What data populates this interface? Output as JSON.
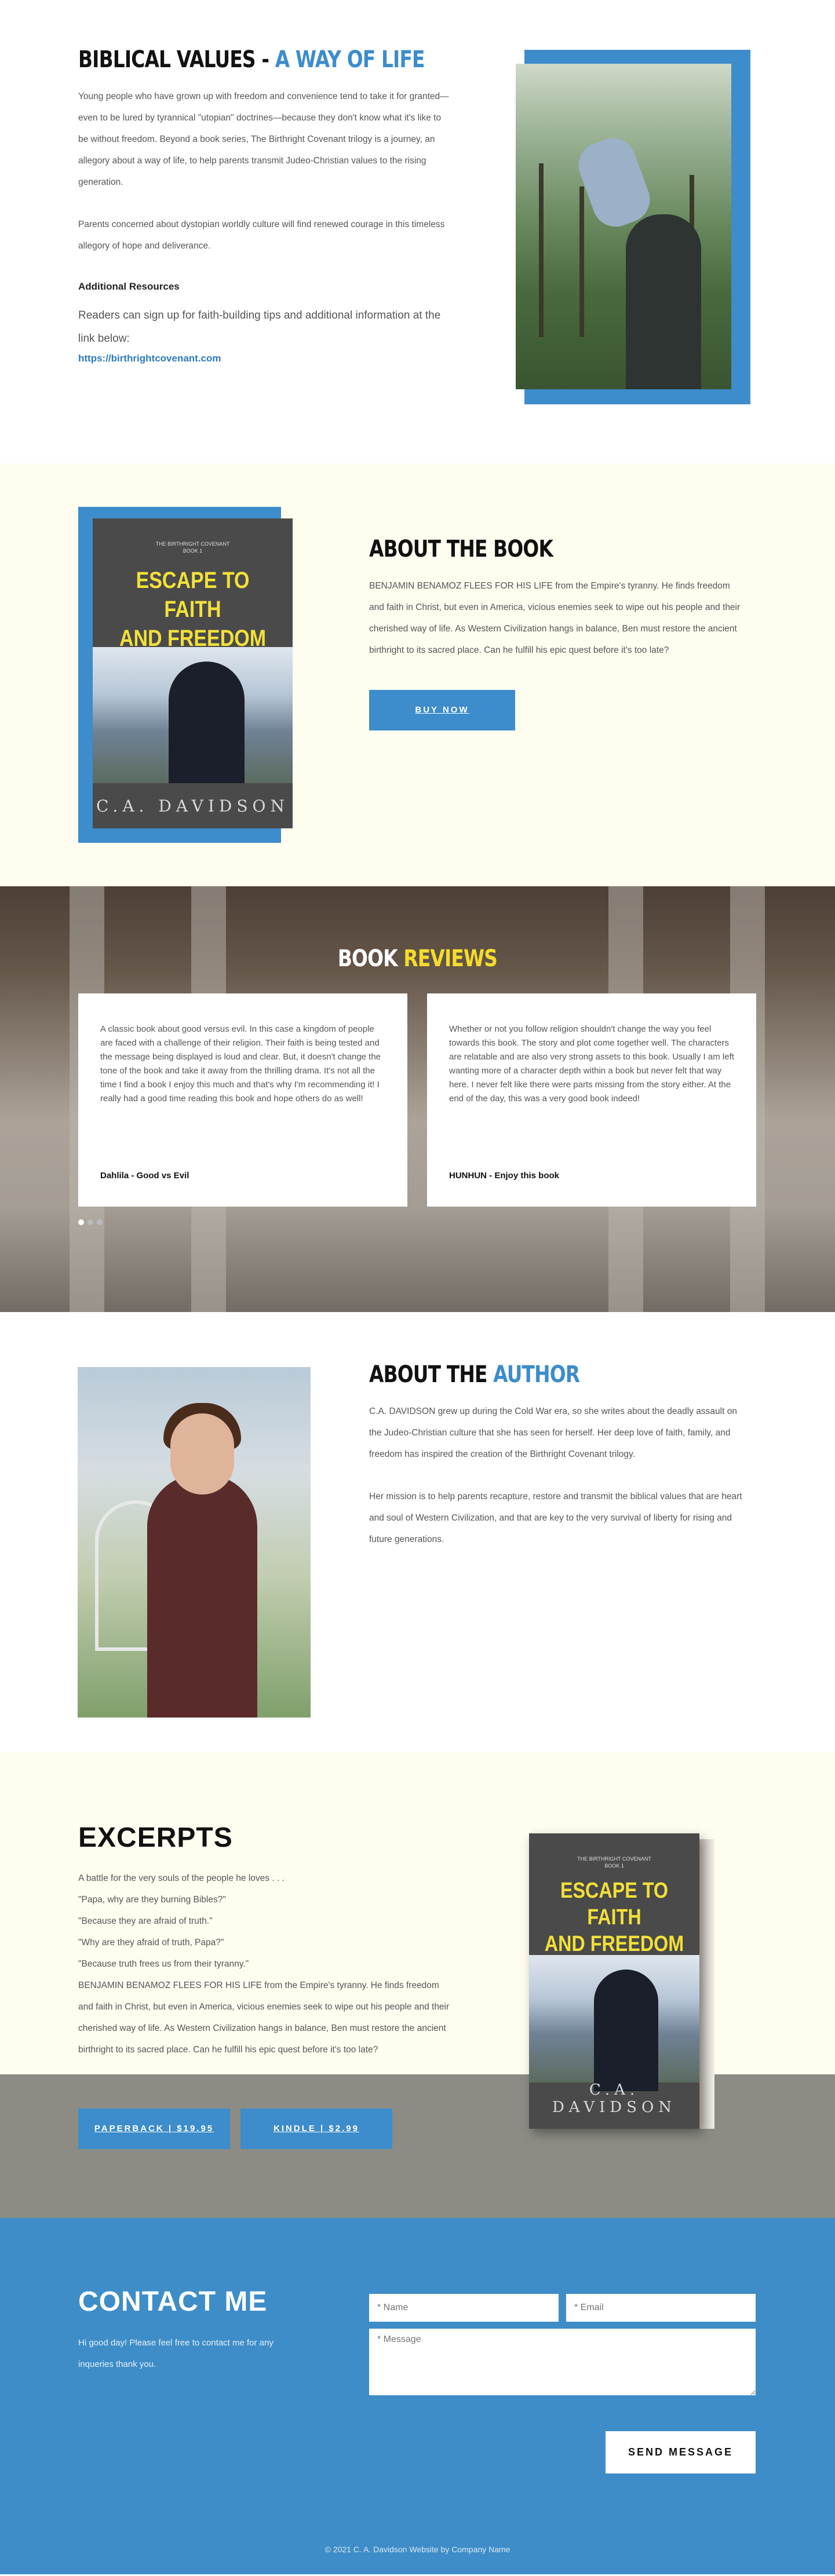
{
  "values": {
    "title_main": "BIBLICAL VALUES - ",
    "title_accent": "A WAY OF LIFE",
    "paragraph1": "Young people who have grown up with freedom and convenience tend to take it for granted—even to be lured by tyrannical \"utopian\" doctrines—because they don't know what it's like to be without freedom. Beyond a book series, The Birthright Covenant trilogy is a journey, an allegory about a way of life, to help parents transmit Judeo-Christian values to the rising generation.",
    "paragraph2": "Parents concerned about dystopian worldly culture will find renewed courage in this timeless allegory of hope and deliverance.",
    "additional_heading": "Additional Resources",
    "signup_text": "Readers can sign up for faith-building tips and additional information at the link below:",
    "link_text": "https://birthrightcovenant.com"
  },
  "about_book": {
    "title": "ABOUT THE BOOK",
    "description": "BENJAMIN BENAMOZ FLEES FOR HIS LIFE from the Empire's tyranny. He finds freedom and faith in Christ, but even in America, vicious enemies seek to wipe out his people and their cherished way of life. As Western Civilization hangs in balance, Ben must restore the ancient birthright to its sacred place. Can he fulfill his epic quest before it's too late?",
    "buy_label": "BUY NOW"
  },
  "cover": {
    "series": "THE BIRTHRIGHT COVENANT",
    "book": "BOOK 1",
    "title_line1": "ESCAPE TO FAITH",
    "title_line2": "AND FREEDOM",
    "author": "C.A. DAVIDSON"
  },
  "reviews": {
    "title_main": "BOOK ",
    "title_accent": "REVIEWS",
    "items": [
      {
        "text": "A classic book about good versus evil. In this case a kingdom of people are faced with a challenge of their religion. Their faith is being tested and the message being displayed is loud and clear. But, it doesn't change the tone of the book and take it away from the thrilling drama. It's not all the time I find a book I enjoy this much and that's why I'm recommending it! I really had a good time reading this book and hope others do as well!",
        "author": "Dahlila - Good vs Evil"
      },
      {
        "text": "Whether or not you follow religion shouldn't change the way you feel towards this book. The story and plot come together well. The characters are relatable and are also very strong assets to this book. Usually I am left wanting more of a character depth within a book but never felt that way here. I never felt like there were parts missing from the story either. At the end of the day, this was a very good book indeed!",
        "author": "HUNHUN - Enjoy this book"
      }
    ]
  },
  "author": {
    "title_main": "ABOUT THE ",
    "title_accent": "AUTHOR",
    "paragraph1": "C.A. DAVIDSON grew up during the Cold War era, so she writes about the deadly assault on the Judeo-Christian culture that she has seen for herself. Her deep love of faith, family, and freedom has inspired the creation of the Birthright Covenant trilogy.",
    "paragraph2": "Her mission is to help parents recapture, restore and transmit the biblical values that are heart and soul of Western Civilization, and that are key to the very survival of liberty for rising and future generations."
  },
  "excerpts": {
    "title": "EXCERPTS",
    "lines": [
      "A battle for the very souls of the people he loves . . .",
      "\"Papa, why are they burning Bibles?\"",
      "\"Because they are afraid of truth.\"",
      "\"Why are they afraid of truth, Papa?\"",
      "\"Because truth frees us from their tyranny.\"",
      "BENJAMIN BENAMOZ FLEES FOR HIS LIFE from the Empire's tyranny. He finds freedom and faith in Christ, but even in America, vicious enemies seek to wipe out his people and their cherished way of life. As Western Civilization hangs in balance, Ben must restore the ancient birthright to its sacred place. Can he fulfill his epic quest before it's too late?"
    ],
    "paperback_label": "PAPERBACK | $19.95",
    "kindle_label": "KINDLE | $2.99"
  },
  "contact": {
    "title": "CONTACT ME",
    "intro": "Hi good day! Please feel free to contact me for any inqueries thank you.",
    "name_placeholder": "* Name",
    "email_placeholder": "* Email",
    "message_placeholder": "* Message",
    "send_label": "SEND MESSAGE",
    "footer": "© 2021 C. A. Davidson Website by Company Name"
  },
  "colors": {
    "accent_blue": "#3d8ccb",
    "accent_yellow": "#f5dc2b",
    "cream": "#fffdf0",
    "band_gray": "#8c8c84"
  }
}
